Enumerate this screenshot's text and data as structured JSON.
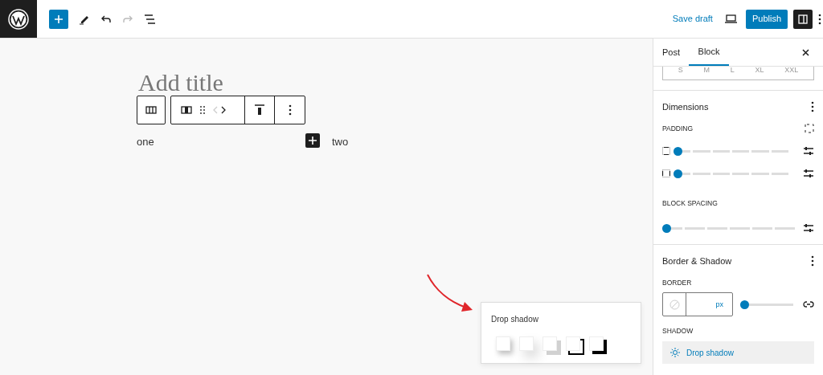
{
  "topbar": {
    "save_draft": "Save draft",
    "publish": "Publish"
  },
  "editor": {
    "title_placeholder": "Add title",
    "columns": [
      "one",
      "two"
    ]
  },
  "sidebar": {
    "tabs": [
      {
        "label": "Post",
        "selected": false
      },
      {
        "label": "Block",
        "selected": true
      }
    ],
    "sizes": [
      "S",
      "M",
      "L",
      "XL",
      "XXL"
    ],
    "dimensions": {
      "title": "Dimensions",
      "padding_label": "PADDING",
      "padding": [
        {
          "kind": "vertical",
          "level": 0
        },
        {
          "kind": "horizontal",
          "level": 0
        }
      ],
      "block_spacing_label": "BLOCK SPACING",
      "block_spacing": {
        "level": 0
      }
    },
    "border_shadow": {
      "title": "Border & Shadow",
      "border_label": "BORDER",
      "border_unit": "px",
      "border": {
        "level": 0
      },
      "shadow_label": "SHADOW",
      "shadow_button": "Drop shadow"
    }
  },
  "popover": {
    "title": "Drop shadow",
    "presets": [
      {
        "kind": "natural"
      },
      {
        "kind": "deep"
      },
      {
        "kind": "sharp"
      },
      {
        "kind": "outlined"
      },
      {
        "kind": "crisp"
      }
    ]
  }
}
